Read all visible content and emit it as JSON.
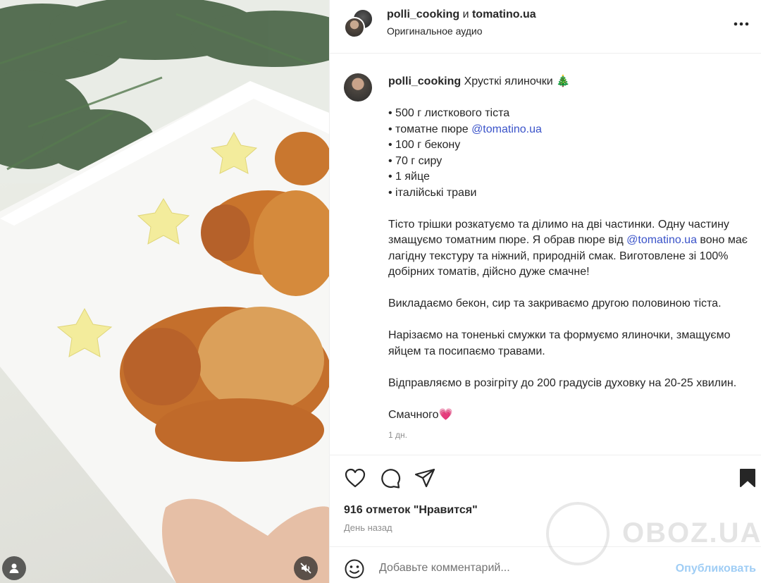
{
  "header": {
    "author": "polli_cooking",
    "conjunction": "и",
    "collaborator": "tomatino.ua",
    "audio": "Оригинальное аудио",
    "more_icon": "more-horizontal-icon"
  },
  "caption": {
    "username": "polli_cooking",
    "title": "Хрусткі ялиночки 🎄",
    "ingredients": [
      "• 500 г листкового тіста",
      "• томатне пюре ",
      "• 100 г бекону",
      "• 70 г сиру",
      "• 1 яйце",
      "• італійські трави"
    ],
    "mention": "@tomatino.ua",
    "para1_a": "Тісто трішки розкатуємо та ділимо на дві частинки. Одну частину змащуємо томатним пюре. Я обрав пюре від ",
    "para1_b": " воно має лагідну текстуру та ніжний, природній смак. Виготовлене зі 100% добірних томатів, дійсно дуже смачне!",
    "para2": "Викладаємо бекон, сир та закриваємо другою половиною тіста.",
    "para3": "Нарізаємо на тоненькі смужки та формуємо ялиночки, змащуємо яйцем та посипаємо травами.",
    "para4": "Відправляємо в розігріту до 200 градусів духовку на 20-25 хвилин.",
    "para5": "Смачного💗",
    "time": "1 дн."
  },
  "actions": {
    "likes": "916 отметок \"Нравится\"",
    "posted": "День назад"
  },
  "comment": {
    "placeholder": "Добавьте комментарий...",
    "publish": "Опубликовать"
  },
  "watermark": "OBOZ.UA",
  "colors": {
    "link": "#3a53c9",
    "publish": "#9fcdf5",
    "muted": "#8e8e8e"
  }
}
